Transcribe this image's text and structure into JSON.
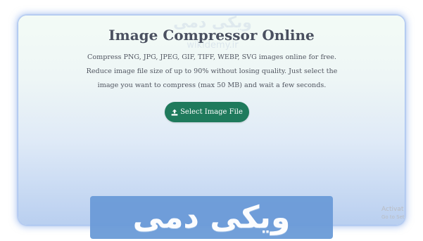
{
  "watermark": {
    "top_logo": "ویکی دمی",
    "top_url": "wikidemy.ir",
    "banner_logo": "ویکی دمی"
  },
  "main": {
    "title": "Image Compressor Online",
    "description_lines": [
      "Compress PNG, JPG, JPEG, GIF, TIFF, WEBP, SVG images online for free.",
      "Reduce image file size of up to 90% without losing quality. Just select the",
      "image you want to compress (max 50 MB) and wait a few seconds."
    ],
    "select_button_label": "Select Image File",
    "select_button_icon": "upload-icon"
  },
  "os_overlay": {
    "activate_line1": "Activat",
    "activate_line2": "Go to Set"
  },
  "colors": {
    "button_bg": "#1f7a5c",
    "title_text": "#4a5060",
    "banner_bg": "#6b9bd8"
  }
}
